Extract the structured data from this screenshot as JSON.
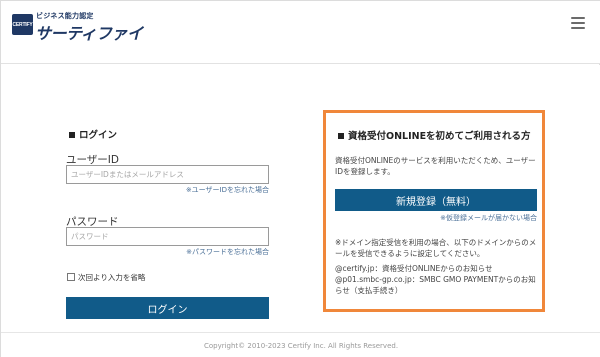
{
  "header": {
    "logo_mark": "CERTIFY",
    "logo_tagline": "ビジネス能力認定",
    "logo_name": "サーティファイ",
    "menu_icon": "hamburger-menu-icon"
  },
  "login": {
    "title": "ログイン",
    "user_id_label": "ユーザーID",
    "user_id_placeholder": "ユーザーIDまたはメールアドレス",
    "forgot_user_id": "※ユーザーIDを忘れた場合",
    "password_label": "パスワード",
    "password_placeholder": "パスワード",
    "forgot_password": "※パスワードを忘れた場合",
    "remember_label": "次回より入力を省略",
    "remember_checked": false,
    "submit_label": "ログイン"
  },
  "signup": {
    "title": "資格受付ONLINEを初めてご利用される方",
    "description": "資格受付ONLINEのサービスを利用いただくため、ユーザーIDを登録します。",
    "register_label": "新規登録（無料）",
    "mail_not_arrived": "※仮登録メールが届かない場合",
    "domain_note": "※ドメイン指定受信を利用の場合、以下のドメインからのメールを受信できるように設定してください。",
    "domain_info_1": "@certify.jp：資格受付ONLINEからのお知らせ",
    "domain_info_2": "@p01.smbc-gp.co.jp：SMBC GMO PAYMENTからのお知らせ（支払手続き）"
  },
  "footer": {
    "copyright": "Copyright© 2010-2023 Certify Inc. All Rights Reserved."
  },
  "colors": {
    "primary_button": "#115b89",
    "highlight_border": "#f0873a",
    "brand": "#1f3864",
    "link": "#4a6f97"
  }
}
